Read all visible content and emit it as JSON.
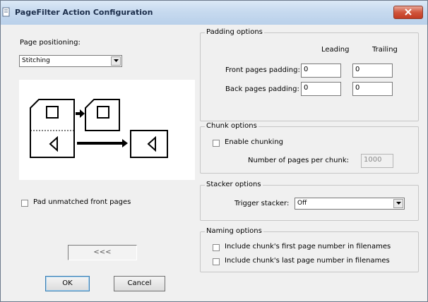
{
  "window": {
    "title": "PageFilter Action Configuration"
  },
  "page_positioning": {
    "label": "Page positioning:",
    "selected": "Stitching"
  },
  "preview": {
    "icon": "page-stitching-diagram"
  },
  "pad_unmatched": {
    "label": "Pad unmatched front pages",
    "checked": false
  },
  "nav_button": {
    "label": "<<<"
  },
  "buttons": {
    "ok": "OK",
    "cancel": "Cancel"
  },
  "padding": {
    "title": "Padding options",
    "col_leading": "Leading",
    "col_trailing": "Trailing",
    "front_label": "Front pages padding:",
    "front_leading": "0",
    "front_trailing": "0",
    "back_label": "Back pages padding:",
    "back_leading": "0",
    "back_trailing": "0"
  },
  "chunk": {
    "title": "Chunk options",
    "enable_label": "Enable chunking",
    "enabled": false,
    "pages_label": "Number of pages per chunk:",
    "pages_value": "1000"
  },
  "stacker": {
    "title": "Stacker options",
    "trigger_label": "Trigger stacker:",
    "trigger_value": "Off"
  },
  "naming": {
    "title": "Naming options",
    "first_label": "Include chunk's first page number in filenames",
    "first_checked": false,
    "last_label": "Include chunk's last page number in filenames",
    "last_checked": false
  },
  "colors": {
    "titlebar": "#c7daef",
    "close_button": "#c94a33",
    "face": "#f0f0f0"
  }
}
